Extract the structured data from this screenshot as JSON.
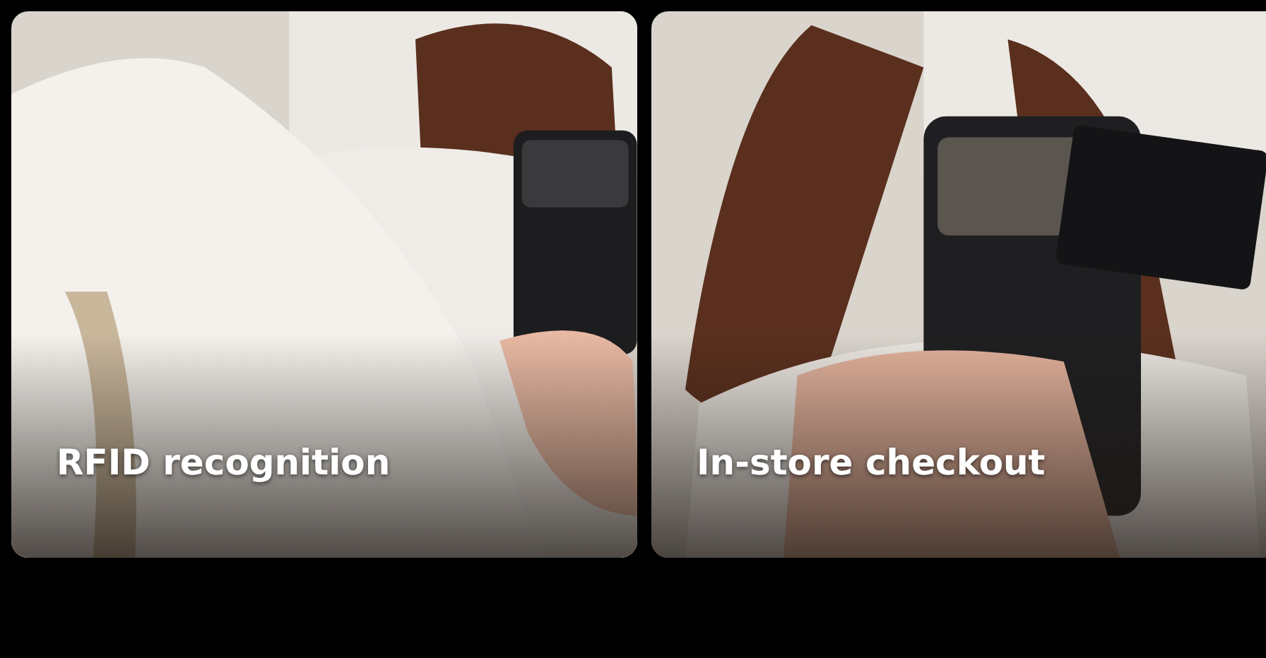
{
  "cards": [
    {
      "caption": "RFID recognition"
    },
    {
      "caption": "In-store checkout"
    }
  ]
}
